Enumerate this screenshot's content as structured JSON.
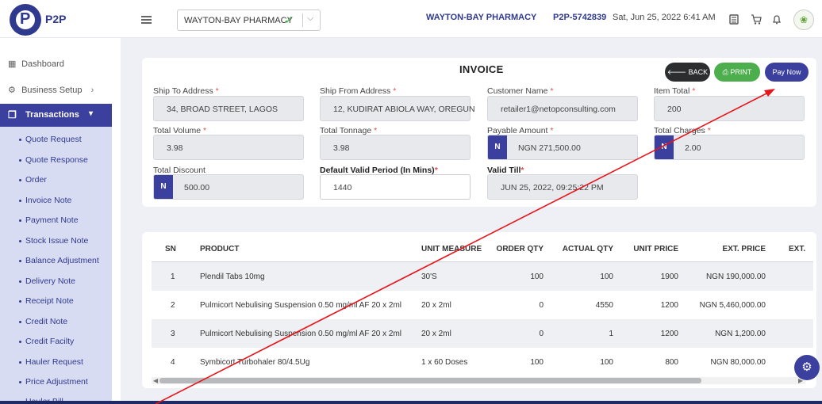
{
  "app": {
    "logo_text": "P2P"
  },
  "header": {
    "pharmacy_select": "WAYTON-BAY PHARMACY",
    "pharmacy_name": "WAYTON-BAY PHARMACY",
    "code": "P2P-5742839",
    "datetime": "Sat, Jun 25, 2022 6:41 AM",
    "icons": [
      "calculator-icon",
      "cart-icon",
      "bell-icon",
      "avatar"
    ]
  },
  "sidebar": {
    "dashboard": "Dashboard",
    "business_setup": "Business Setup",
    "transactions": "Transactions",
    "sub_items": [
      "Quote Request",
      "Quote Response",
      "Order",
      "Invoice Note",
      "Payment Note",
      "Stock Issue Note",
      "Balance Adjustment",
      "Delivery Note",
      "Receipt Note",
      "Credit Note",
      "Credit Facilty",
      "Hauler Request",
      "Price Adjustment",
      "Hauler Bill"
    ]
  },
  "invoice": {
    "title": "INVOICE",
    "buttons": {
      "back": "BACK",
      "print": "PRINT",
      "pay": "Pay Now"
    },
    "currency_pill": "N",
    "fields": {
      "ship_to": {
        "label": "Ship To Address",
        "value": "34, BROAD STREET, LAGOS"
      },
      "ship_from": {
        "label": "Ship From Address",
        "value": "12, KUDIRAT ABIOLA WAY, OREGUN"
      },
      "customer": {
        "label": "Customer Name",
        "value": "retailer1@netopconsulting.com"
      },
      "item_total": {
        "label": "Item Total",
        "value": "200"
      },
      "total_volume": {
        "label": "Total Volume",
        "value": "3.98"
      },
      "total_tonnage": {
        "label": "Total Tonnage",
        "value": "3.98"
      },
      "payable": {
        "label": "Payable Amount",
        "value": "NGN 271,500.00"
      },
      "total_charges": {
        "label": "Total Charges",
        "value": "2.00"
      },
      "total_discount": {
        "label": "Total Discount",
        "value": "500.00"
      },
      "valid_period": {
        "label": "Default Valid Period (In Mins)",
        "value": "1440"
      },
      "valid_till": {
        "label": "Valid Till",
        "value": "JUN 25, 2022,  09:25:22 PM"
      }
    }
  },
  "table": {
    "headers": [
      "SN",
      "PRODUCT",
      "UNIT MEASURE",
      "ORDER QTY",
      "ACTUAL QTY",
      "UNIT PRICE",
      "EXT. PRICE",
      "EXT."
    ],
    "rows": [
      {
        "sn": "1",
        "product": "Plendil Tabs 10mg",
        "unit": "30'S",
        "order_qty": "100",
        "actual_qty": "100",
        "unit_price": "1900",
        "ext_price": "NGN 190,000.00"
      },
      {
        "sn": "2",
        "product": "Pulmicort Nebulising Suspension 0.50 mg/ml AF 20 x 2ml",
        "unit": "20 x 2ml",
        "order_qty": "0",
        "actual_qty": "4550",
        "unit_price": "1200",
        "ext_price": "NGN 5,460,000.00"
      },
      {
        "sn": "3",
        "product": "Pulmicort Nebulising Suspension 0.50 mg/ml AF 20 x 2ml",
        "unit": "20 x 2ml",
        "order_qty": "0",
        "actual_qty": "1",
        "unit_price": "1200",
        "ext_price": "NGN 1,200.00"
      },
      {
        "sn": "4",
        "product": "Symbicort Turbohaler 80/4.5Ug",
        "unit": "1 x 60 Doses",
        "order_qty": "100",
        "actual_qty": "100",
        "unit_price": "800",
        "ext_price": "NGN 80,000.00"
      }
    ]
  }
}
